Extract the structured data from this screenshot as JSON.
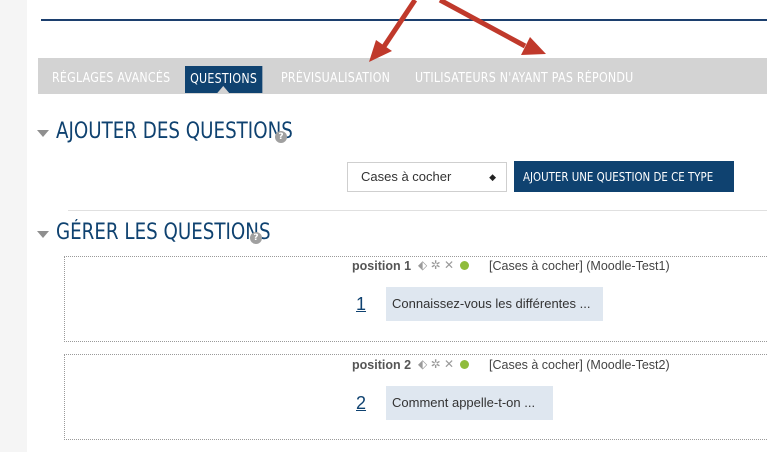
{
  "tabs": [
    {
      "label": "Réglages avancés",
      "active": false
    },
    {
      "label": "Questions",
      "active": true
    },
    {
      "label": "Prévisualisation",
      "active": false
    },
    {
      "label": "Utilisateurs n'ayant pas répondu",
      "active": false
    }
  ],
  "add_section": {
    "title": "Ajouter des questions",
    "select_value": "Cases à cocher",
    "button_label": "Ajouter une question de ce type"
  },
  "manage_section": {
    "title": "Gérer les questions"
  },
  "questions": [
    {
      "position": "position 1",
      "type": "[Cases à cocher] (Moodle-Test1)",
      "number": "1",
      "text": "Connaissez-vous les différentes ..."
    },
    {
      "position": "position 2",
      "type": "[Cases à cocher] (Moodle-Test2)",
      "number": "2",
      "text": "Comment appelle-t-on ..."
    }
  ],
  "icons": {
    "help": "question-circle-icon",
    "move": "move-icon",
    "edit": "gear-icon",
    "delete": "close-icon",
    "status": "status-dot-icon",
    "collapse": "caret-down-icon"
  },
  "colors": {
    "brand": "#0f4270",
    "tabbar": "#d3d3d3",
    "question_bg": "#dfe7f0",
    "status_dot": "#8fbc3c",
    "annotation_arrow": "#c0392b"
  }
}
